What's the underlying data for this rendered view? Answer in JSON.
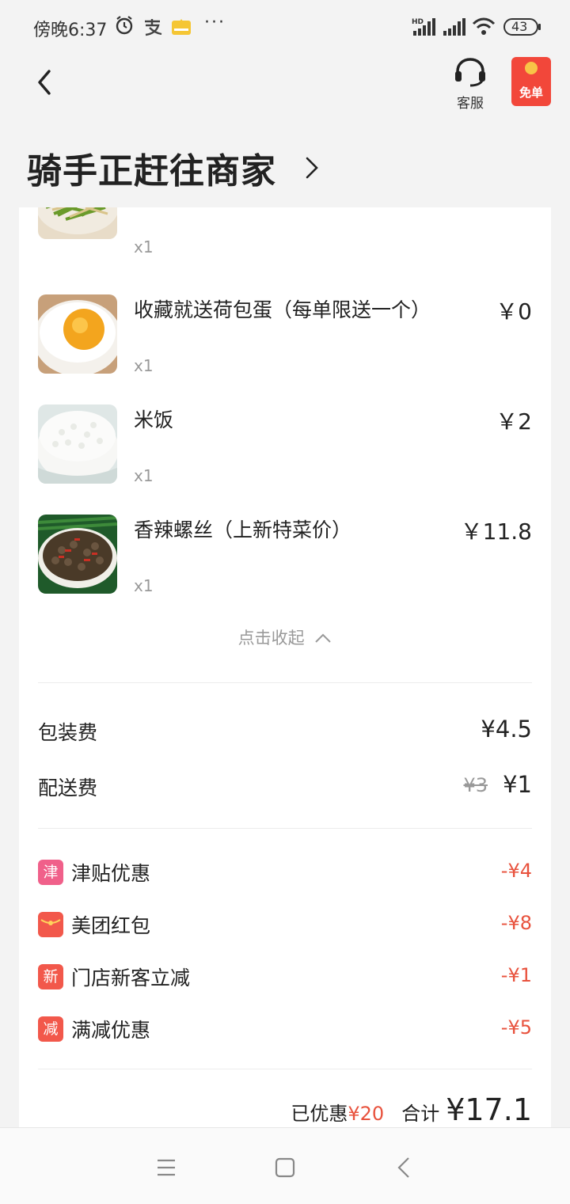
{
  "status_bar": {
    "time": "傍晚6:37",
    "more": "···",
    "battery": "43"
  },
  "header": {
    "customer_service_label": "客服",
    "free_order_label": "免单"
  },
  "order_status": {
    "title": "骑手正赶往商家"
  },
  "items": [
    {
      "name": "",
      "price": "",
      "qty": "x1"
    },
    {
      "name": "收藏就送荷包蛋（每单限送一个）",
      "price": "￥0",
      "qty": "x1"
    },
    {
      "name": "米饭",
      "price": "￥2",
      "qty": "x1"
    },
    {
      "name": "香辣螺丝（上新特菜价）",
      "price": "￥11.8",
      "qty": "x1"
    }
  ],
  "collapse_label": "点击收起",
  "fees": {
    "packing_label": "包装费",
    "packing_value": "¥4.5",
    "delivery_label": "配送费",
    "delivery_original": "¥3",
    "delivery_value": "¥1"
  },
  "discounts": [
    {
      "badge": "津",
      "name": "津贴优惠",
      "value": "-¥4",
      "color": "#f0608a"
    },
    {
      "badge": "",
      "name": "美团红包",
      "value": "-¥8",
      "color": "#f2584b"
    },
    {
      "badge": "新",
      "name": "门店新客立减",
      "value": "-¥1",
      "color": "#f2584b"
    },
    {
      "badge": "减",
      "name": "满减优惠",
      "value": "-¥5",
      "color": "#f2584b"
    }
  ],
  "summary": {
    "saved_label": "已优惠",
    "saved_amount": "¥20",
    "total_label": "合计",
    "total_value": "¥17.1"
  },
  "colors": {
    "accent_red": "#e8523d",
    "background": "#f3f3f3"
  }
}
